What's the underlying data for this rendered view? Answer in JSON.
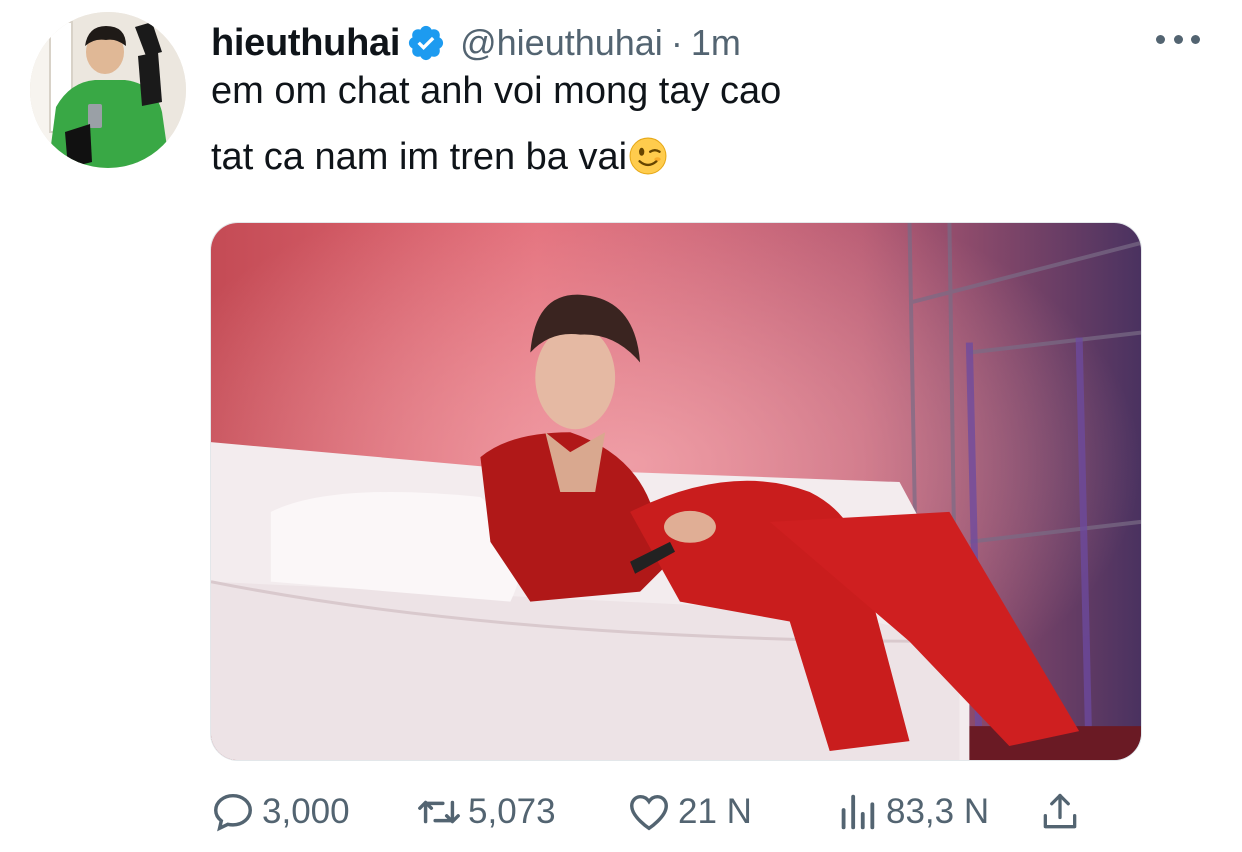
{
  "tweet": {
    "display_name": "hieuthuhai",
    "handle": "@hieuthuhai",
    "separator": "·",
    "timestamp": "1m",
    "text_line1": "em om chat anh voi mong tay cao",
    "text_line2": "tat ca nam im tren ba vai",
    "emoji": "winking-face"
  },
  "actions": {
    "replies": "3,000",
    "retweets": "5,073",
    "likes": "21 N",
    "views": "83,3 N"
  },
  "colors": {
    "verified": "#1d9bf0",
    "secondary_text": "#536471",
    "primary_text": "#0f1419"
  }
}
